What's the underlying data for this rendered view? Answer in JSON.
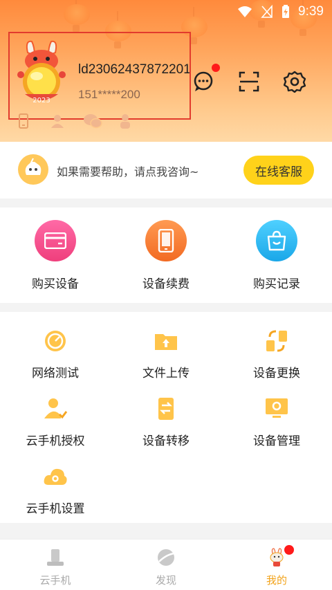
{
  "status_bar": {
    "time": "9:39"
  },
  "profile": {
    "username": "ld23062437872201",
    "phone": "151*****200",
    "badge_year": "2023"
  },
  "header_actions": {
    "message_icon": "chat-bubble-icon",
    "scan_icon": "scan-icon",
    "settings_icon": "gear-icon"
  },
  "help": {
    "text": "如果需要帮助，请点我咨询~",
    "button_label": "在线客服"
  },
  "buy_section": {
    "items": [
      {
        "label": "购买设备",
        "color": "#f2468d"
      },
      {
        "label": "设备续费",
        "color": "#f47a2c"
      },
      {
        "label": "购买记录",
        "color": "#29b6f0"
      }
    ]
  },
  "tools": {
    "items": [
      {
        "label": "网络测试"
      },
      {
        "label": "文件上传"
      },
      {
        "label": "设备更换"
      },
      {
        "label": "云手机授权"
      },
      {
        "label": "设备转移"
      },
      {
        "label": "设备管理"
      },
      {
        "label": "云手机设置"
      }
    ]
  },
  "tabbar": {
    "tabs": [
      {
        "label": "云手机"
      },
      {
        "label": "发现"
      },
      {
        "label": "我的"
      }
    ]
  },
  "colors": {
    "accent": "#f2a31b",
    "button_yellow": "#ffd21a",
    "header_orange": "#ff8a3c"
  }
}
